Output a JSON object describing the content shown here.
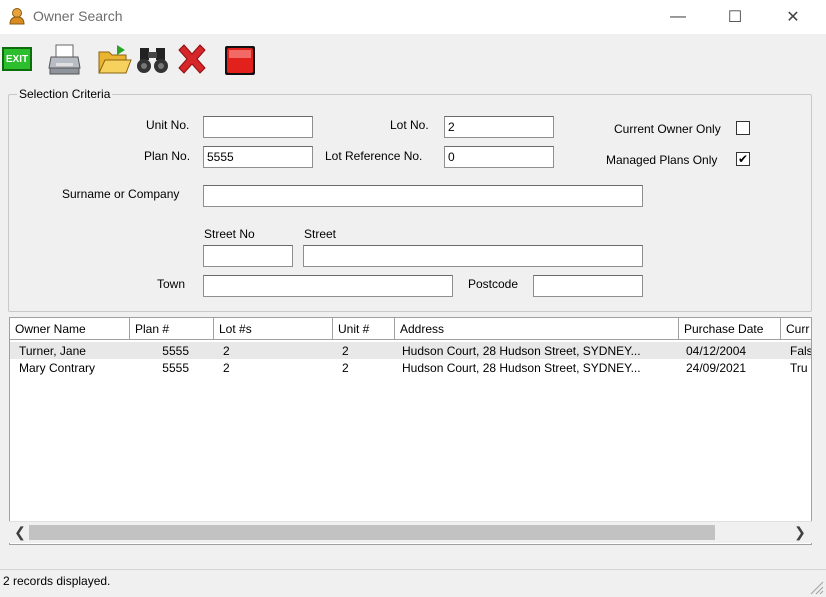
{
  "window": {
    "title": "Owner Search",
    "minimize": "—",
    "maximize": "☐",
    "close": "✕"
  },
  "toolbar": {
    "exit_label": "EXIT",
    "buttons": [
      "exit",
      "print",
      "open",
      "find",
      "clear",
      "stop"
    ]
  },
  "criteria": {
    "group_title": "Selection Criteria",
    "unit_no_label": "Unit No.",
    "unit_no_value": "",
    "lot_no_label": "Lot No.",
    "lot_no_value": "2",
    "current_owner_label": "Current Owner Only",
    "current_owner_checked": false,
    "plan_no_label": "Plan No.",
    "plan_no_value": "5555",
    "lot_ref_label": "Lot Reference No.",
    "lot_ref_value": "0",
    "managed_plans_label": "Managed Plans Only",
    "managed_plans_checked": true,
    "surname_label": "Surname or Company",
    "surname_value": "",
    "street_no_label": "Street No",
    "street_no_value": "",
    "street_label": "Street",
    "street_value": "",
    "town_label": "Town",
    "town_value": "",
    "postcode_label": "Postcode",
    "postcode_value": ""
  },
  "results": {
    "columns": [
      "Owner Name",
      "Plan #",
      "Lot #s",
      "Unit #",
      "Address",
      "Purchase Date",
      "Curr"
    ],
    "rows": [
      [
        "Turner, Jane",
        "5555",
        "2",
        "2",
        "Hudson Court, 28 Hudson Street, SYDNEY...",
        "04/12/2004",
        "Fals"
      ],
      [
        "Mary Contrary",
        "5555",
        "2",
        "2",
        "Hudson Court, 28 Hudson Street, SYDNEY...",
        "24/09/2021",
        "Tru"
      ]
    ]
  },
  "status": {
    "text": "2 records displayed."
  }
}
